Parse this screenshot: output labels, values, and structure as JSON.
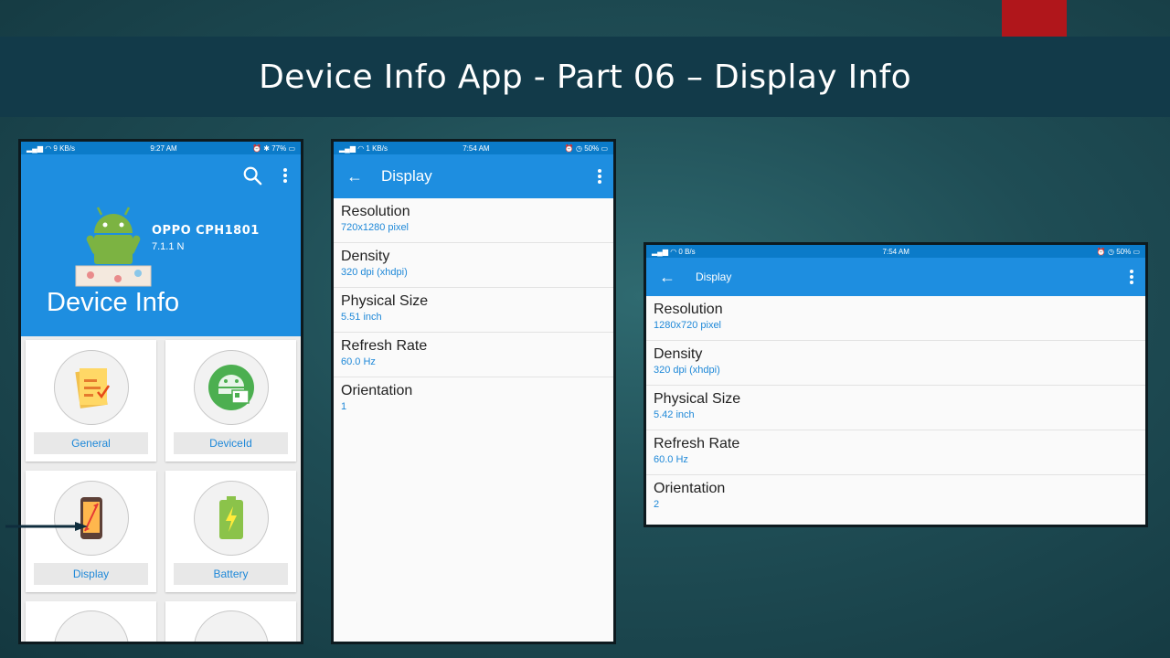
{
  "slide": {
    "title": "Device Info App - Part 06 – Display Info"
  },
  "phone_main": {
    "status": {
      "left": "9 KB/s",
      "time": "9:27 AM",
      "right": "77%"
    },
    "device_name": "OPPO CPH1801",
    "android_version": "7.1.1 N",
    "app_title": "Device Info",
    "cards": [
      {
        "label": "General",
        "icon": "notepad-icon"
      },
      {
        "label": "DeviceId",
        "icon": "device-id-icon"
      },
      {
        "label": "Display",
        "icon": "phone-resize-icon"
      },
      {
        "label": "Battery",
        "icon": "battery-icon"
      }
    ]
  },
  "phone_portrait": {
    "status": {
      "left": "1 KB/s",
      "time": "7:54 AM",
      "right": "50%"
    },
    "appbar_title": "Display",
    "rows": [
      {
        "label": "Resolution",
        "value": "720x1280 pixel"
      },
      {
        "label": "Density",
        "value": "320 dpi (xhdpi)"
      },
      {
        "label": "Physical Size",
        "value": "5.51 inch"
      },
      {
        "label": "Refresh Rate",
        "value": "60.0 Hz"
      },
      {
        "label": "Orientation",
        "value": "1"
      }
    ]
  },
  "phone_landscape": {
    "status": {
      "left": "0 B/s",
      "time": "7:54 AM",
      "right": "50%"
    },
    "appbar_title": "Display",
    "rows": [
      {
        "label": "Resolution",
        "value": "1280x720 pixel"
      },
      {
        "label": "Density",
        "value": "320 dpi (xhdpi)"
      },
      {
        "label": "Physical Size",
        "value": "5.42 inch"
      },
      {
        "label": "Refresh Rate",
        "value": "60.0 Hz"
      },
      {
        "label": "Orientation",
        "value": "2"
      }
    ]
  },
  "colors": {
    "primary": "#1e8ee0",
    "status_bar": "#0b7bc9",
    "value_text": "#1e88d8",
    "title_bar": "#123a49"
  }
}
